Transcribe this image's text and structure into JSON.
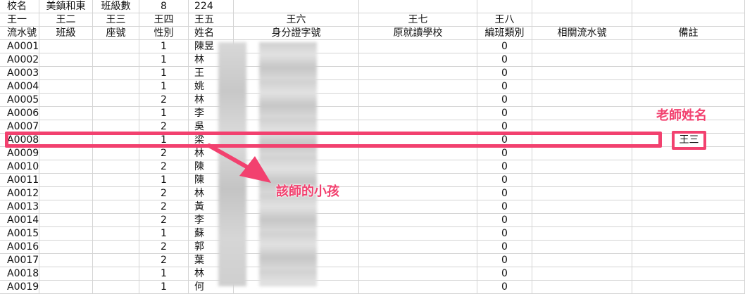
{
  "meta_row": [
    "校名",
    "美鎮和東",
    "班級數",
    "8",
    "224",
    "",
    "",
    "",
    "",
    ""
  ],
  "header_row1": [
    "王一",
    "王二",
    "王三",
    "王四",
    "王五",
    "王六",
    "王七",
    "王八",
    "",
    ""
  ],
  "header_row2": [
    "流水號",
    "班級",
    "座號",
    "性別",
    "姓名",
    "身分證字號",
    "原就讀學校",
    "編班類別",
    "相關流水號",
    "備註"
  ],
  "rows": [
    {
      "id": "A0001",
      "gender": "1",
      "name": "陳昱",
      "type": "0"
    },
    {
      "id": "A0002",
      "gender": "1",
      "name": "林",
      "type": "0"
    },
    {
      "id": "A0003",
      "gender": "1",
      "name": "王",
      "type": "0"
    },
    {
      "id": "A0004",
      "gender": "1",
      "name": "姚",
      "type": "0"
    },
    {
      "id": "A0005",
      "gender": "2",
      "name": "林",
      "type": "0"
    },
    {
      "id": "A0006",
      "gender": "1",
      "name": "李",
      "type": "0"
    },
    {
      "id": "A0007",
      "gender": "2",
      "name": "吳",
      "type": "0"
    },
    {
      "id": "A0008",
      "gender": "1",
      "name": "梁",
      "type": "0"
    },
    {
      "id": "A0009",
      "gender": "2",
      "name": "林",
      "type": "0"
    },
    {
      "id": "A0010",
      "gender": "2",
      "name": "陳",
      "type": "0"
    },
    {
      "id": "A0011",
      "gender": "1",
      "name": "陳",
      "type": "0"
    },
    {
      "id": "A0012",
      "gender": "2",
      "name": "林",
      "type": "0"
    },
    {
      "id": "A0013",
      "gender": "2",
      "name": "黃",
      "type": "0"
    },
    {
      "id": "A0014",
      "gender": "2",
      "name": "李",
      "type": "0"
    },
    {
      "id": "A0015",
      "gender": "1",
      "name": "蘇",
      "type": "0"
    },
    {
      "id": "A0016",
      "gender": "2",
      "name": "郭",
      "type": "0"
    },
    {
      "id": "A0017",
      "gender": "2",
      "name": "葉",
      "type": "0"
    },
    {
      "id": "A0018",
      "gender": "1",
      "name": "林",
      "type": "0"
    },
    {
      "id": "A0019",
      "gender": "1",
      "name": "何",
      "type": "0"
    }
  ],
  "annotations": {
    "teacher_label": "老師姓名",
    "teacher_value": "王三",
    "child_label": "該師的小孩"
  },
  "colors": {
    "accent": "#f2416f",
    "grid": "#d4d4d4"
  }
}
